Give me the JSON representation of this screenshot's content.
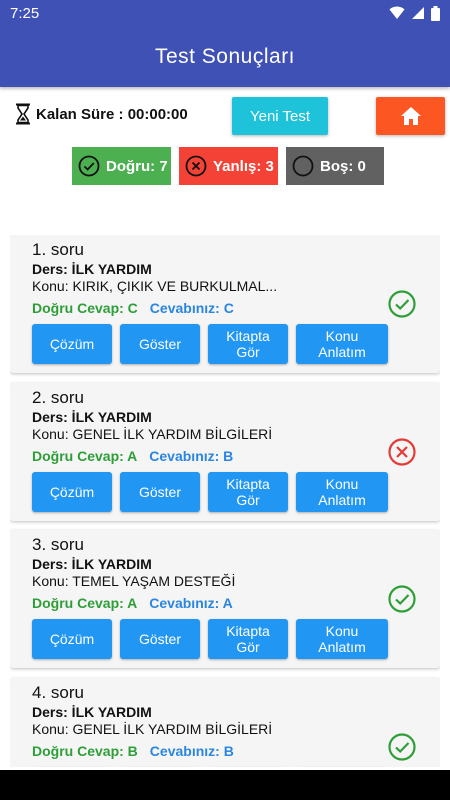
{
  "status": {
    "time": "7:25"
  },
  "header": {
    "title": "Test Sonuçları"
  },
  "timer": {
    "label": "Kalan Süre : 00:00:00"
  },
  "actions": {
    "new_test": "Yeni Test",
    "home_icon": "home-icon"
  },
  "summary": {
    "correct": "Doğru: 7",
    "wrong": "Yanlış: 3",
    "empty": "Boş: 0"
  },
  "colors": {
    "appbar": "#3f51b5",
    "new_test": "#1fc3d9",
    "home": "#fc5722",
    "correct": "#4caf50",
    "wrong": "#f44336",
    "empty": "#616161",
    "action_button": "#2196f3"
  },
  "button_labels": {
    "solution": "Çözüm",
    "show": "Göster",
    "book_line1": "Kitapta",
    "book_line2": "Gör",
    "topic_line1": "Konu",
    "topic_line2": "Anlatım"
  },
  "questions": [
    {
      "title": "1. soru",
      "ders": "Ders: İLK YARDIM",
      "konu": "Konu: KIRIK, ÇIKIK VE BURKULMAL...",
      "correct": "Doğru Cevap: C",
      "yours": "Cevabınız: C",
      "status": "correct"
    },
    {
      "title": "2. soru",
      "ders": "Ders: İLK YARDIM",
      "konu": "Konu: GENEL İLK YARDIM BİLGİLERİ",
      "correct": "Doğru Cevap: A",
      "yours": "Cevabınız: B",
      "status": "wrong"
    },
    {
      "title": "3. soru",
      "ders": "Ders: İLK YARDIM",
      "konu": "Konu: TEMEL YAŞAM DESTEĞİ",
      "correct": "Doğru Cevap: A",
      "yours": "Cevabınız: A",
      "status": "correct"
    },
    {
      "title": "4. soru",
      "ders": "Ders: İLK YARDIM",
      "konu": "Konu: GENEL İLK YARDIM BİLGİLERİ",
      "correct": "Doğru Cevap: B",
      "yours": "Cevabınız: B",
      "status": "correct"
    }
  ]
}
